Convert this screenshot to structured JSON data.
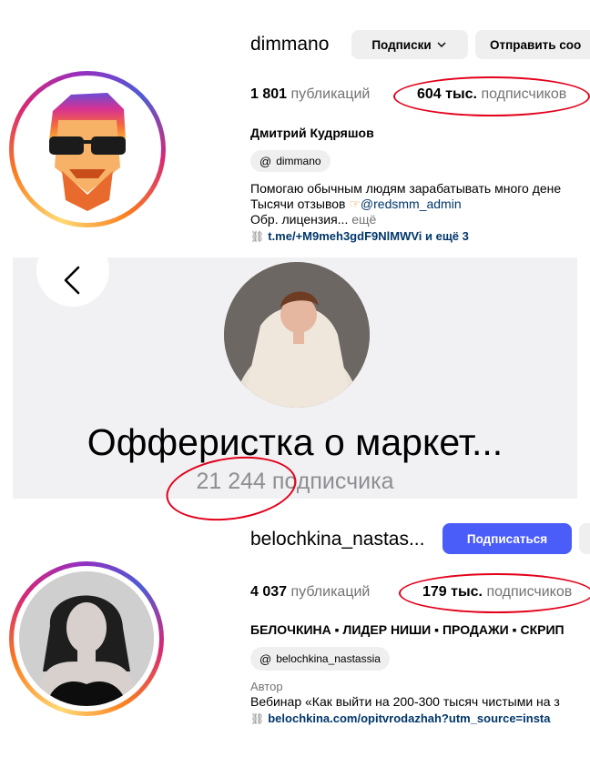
{
  "profile1": {
    "username": "dimmano",
    "follow_button": "Подписки",
    "message_button": "Отправить соо",
    "posts_count": "1 801",
    "posts_label": "публикаций",
    "followers_count": "604 тыс.",
    "followers_label": "подписчиков",
    "full_name": "Дмитрий Кудряшов",
    "threads_handle": "dimmano",
    "bio_line1": "Помогаю обычным людям зарабатывать много дене",
    "bio_line2_text": "Тысячи отзывов",
    "bio_line2_mention": "@redsmm_admin",
    "bio_line3": "Обр. лицензия...",
    "bio_more": "ещё",
    "link_text": "t.me/+M9meh3gdF9NlMWVi и ещё 3"
  },
  "channel": {
    "title": "Офферистка о маркет...",
    "subscribers": "21 244 подписчика"
  },
  "profile2": {
    "username": "belochkina_nastas...",
    "follow_button": "Подписаться",
    "posts_count": "4 037",
    "posts_label": "публикаций",
    "followers_count": "179 тыс.",
    "followers_label": "подписчиков",
    "full_name": "БЕЛОЧКИНА ▪ ЛИДЕР НИШИ ▪ ПРОДАЖИ ▪ СКРИП",
    "threads_handle": "belochkina_nastassia",
    "category": "Автор",
    "bio_line1": "Вебинар «Как выйти на 200-300 тысяч чистыми на з",
    "link_text": "belochkina.com/opitvrodazhah?utm_source=insta"
  },
  "colors": {
    "accent_blue": "#4a5df9",
    "link_blue": "#00376b",
    "highlight_red": "#e3001b",
    "telegram_bg": "#f1f1f3"
  }
}
